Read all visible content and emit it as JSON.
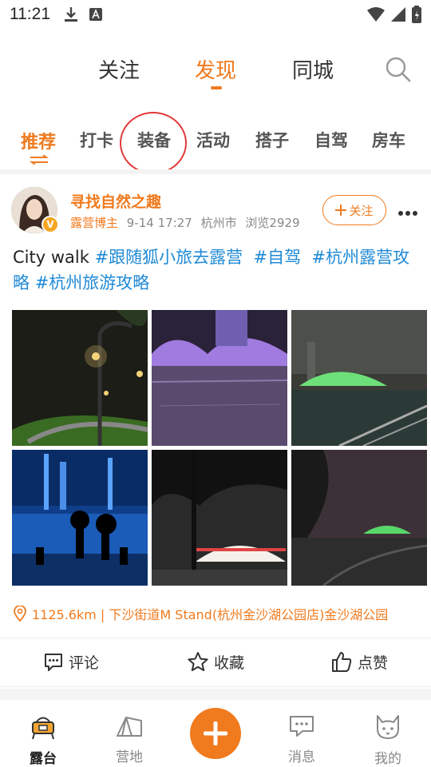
{
  "status_bar": {
    "time": "11:21"
  },
  "top_tabs": [
    {
      "label": "关注"
    },
    {
      "label": "发现"
    },
    {
      "label": "同城"
    }
  ],
  "category_tabs": [
    {
      "label": "推荐"
    },
    {
      "label": "打卡"
    },
    {
      "label": "装备"
    },
    {
      "label": "活动"
    },
    {
      "label": "搭子"
    },
    {
      "label": "自驾"
    },
    {
      "label": "房车"
    }
  ],
  "post": {
    "author": "寻找自然之趣",
    "role": "露营博主",
    "datetime": "9-14 17:27",
    "city": "杭州市",
    "views": "浏览2929",
    "follow_label": "关注",
    "text_plain": "City walk ",
    "tags": [
      "#跟随狐小旅去露营",
      "#自驾",
      "#杭州露营攻略",
      "#杭州旅游攻略"
    ],
    "location": "1125.6km | 下沙街道M Stand(杭州金沙湖公园店)金沙湖公园"
  },
  "actions": {
    "comment": "评论",
    "favorite": "收藏",
    "like": "点赞"
  },
  "bottom_nav": {
    "home": "露台",
    "camp": "营地",
    "messages": "消息",
    "mine": "我的"
  },
  "colors": {
    "accent": "#f07a1e",
    "tag": "#1f8ad6",
    "annotation": "#e23a3a"
  }
}
